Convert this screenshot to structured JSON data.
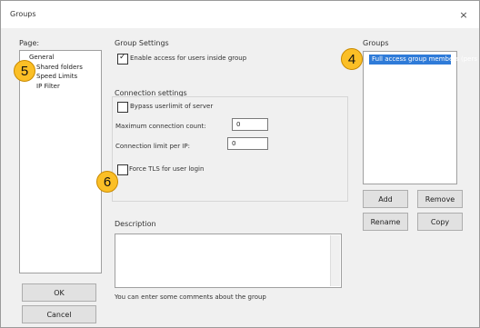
{
  "window": {
    "title": "Groups",
    "close_glyph": "×"
  },
  "page_label": "Page:",
  "tree": {
    "items": [
      "General",
      "Shared folders",
      "Speed Limits",
      "IP Filter"
    ]
  },
  "group_settings": {
    "title": "Group Settings",
    "enable_access": {
      "label": "Enable access for users inside group",
      "checked": true
    }
  },
  "connection_settings": {
    "title": "Connection settings",
    "bypass": {
      "label": "Bypass userlimit of server",
      "checked": false
    },
    "max_conn_label": "Maximum connection count:",
    "max_conn_value": "0",
    "conn_limit_label": "Connection limit per IP:",
    "conn_limit_value": "0",
    "force_tls": {
      "label": "Force TLS for user login",
      "checked": false
    }
  },
  "description": {
    "title": "Description",
    "hint": "You can enter some comments about the group"
  },
  "groups": {
    "title": "Groups",
    "selected": "Full access group members (pers"
  },
  "buttons": {
    "add": "Add",
    "remove": "Remove",
    "rename": "Rename",
    "copy": "Copy",
    "ok": "OK",
    "cancel": "Cancel"
  },
  "badges": {
    "b4": "4",
    "b5": "5",
    "b6": "6"
  },
  "colors": {
    "badge": "#fbbf26",
    "selection": "#2f7bd8"
  }
}
